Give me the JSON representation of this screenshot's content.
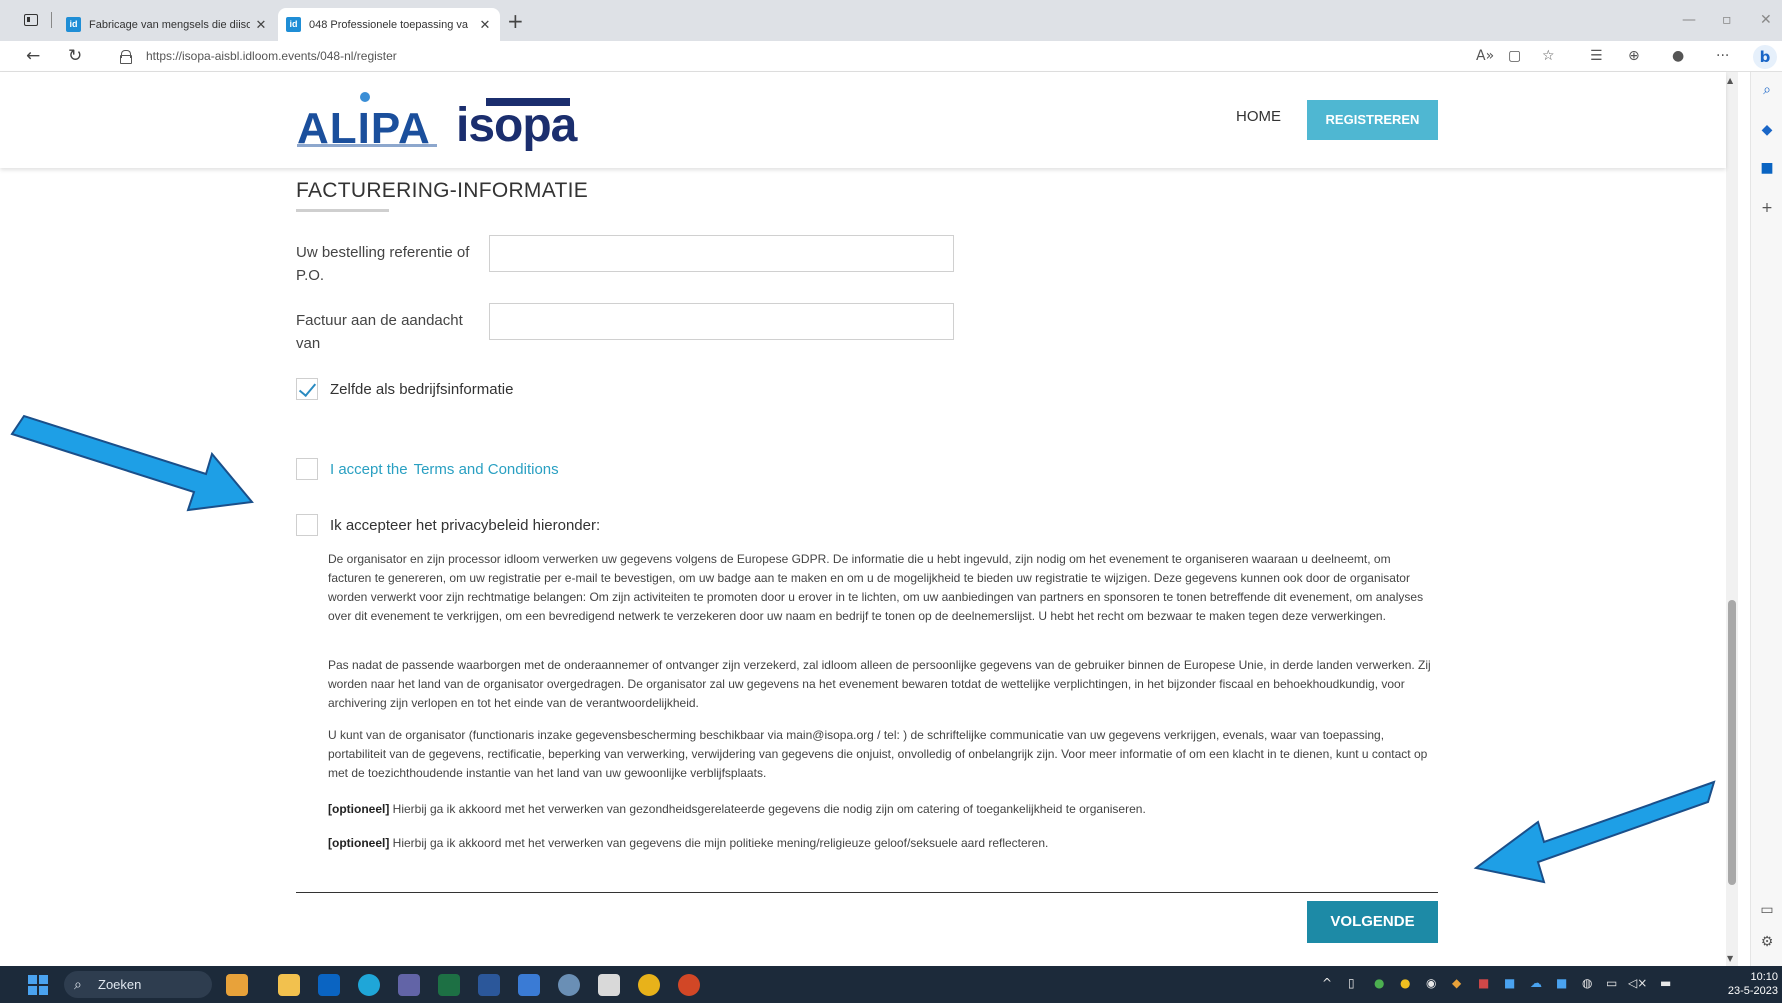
{
  "browser": {
    "tabs": [
      {
        "title": "Fabricage van mengsels die diiso",
        "favicon": "id"
      },
      {
        "title": "048 Professionele toepassing va",
        "favicon": "id"
      }
    ],
    "url": "https://isopa-aisbl.idloom.events/048-nl/register"
  },
  "header": {
    "logo_alipa": "ALIPA",
    "logo_isopa": "isopa",
    "nav_home": "HOME",
    "nav_register": "REGISTREREN"
  },
  "form": {
    "section_title": "FACTURERING-INFORMATIE",
    "order_ref_label": "Uw bestelling referentie of P.O.",
    "order_ref_value": "",
    "attention_label": "Factuur aan de aandacht van",
    "attention_value": "",
    "same_as_company_label": "Zelfde als bedrijfsinformatie",
    "same_as_company_checked": true,
    "terms_prefix": "I accept the",
    "terms_link": "Terms and Conditions",
    "terms_checked": false,
    "privacy_label": "Ik accepteer het privacybeleid hieronder:",
    "privacy_checked": false,
    "privacy_p1": "De organisator en zijn processor idloom verwerken uw gegevens volgens de Europese GDPR. De informatie die u hebt ingevuld, zijn nodig om het evenement te organiseren waaraan u deelneemt, om facturen te genereren, om uw registratie per e-mail te bevestigen, om uw badge aan te maken en om u de mogelijkheid te bieden uw registratie te wijzigen. Deze gegevens kunnen ook door de organisator worden verwerkt voor zijn rechtmatige belangen: Om zijn activiteiten te promoten door u erover in te lichten, om uw aanbiedingen van partners en sponsoren te tonen betreffende dit evenement, om analyses over dit evenement te verkrijgen, om een bevredigend netwerk te verzekeren door uw naam en bedrijf te tonen op de deelnemerslijst. U hebt het recht om bezwaar te maken tegen deze verwerkingen.",
    "privacy_p2": "Pas nadat de passende waarborgen met de onderaannemer of ontvanger zijn verzekerd, zal idloom alleen de persoonlijke gegevens van de gebruiker binnen de Europese Unie, in derde landen verwerken. Zij worden naar het land van de organisator overgedragen. De organisator zal uw gegevens na het evenement bewaren totdat de wettelijke verplichtingen, in het bijzonder fiscaal en behoekhoudkundig, voor archivering zijn verlopen en tot het einde van de verantwoordelijkheid.",
    "privacy_p3": "U kunt van de organisator (functionaris inzake gegevensbescherming beschikbaar via main@isopa.org / tel: ) de schriftelijke communicatie van uw gegevens verkrijgen, evenals, waar van toepassing, portabiliteit van de gegevens, rectificatie, beperking van verwerking, verwijdering van gegevens die onjuist, onvolledig of onbelangrijk zijn. Voor meer informatie of om een klacht in te dienen, kunt u contact op met de toezichthoudende instantie van het land van uw gewoonlijke verblijfsplaats.",
    "optional_tag": "[optioneel]",
    "optional_1": " Hierbij ga ik akkoord met het verwerken van gezondheidsgerelateerde gegevens die nodig zijn om catering of toegankelijkheid te organiseren.",
    "optional_2": " Hierbij ga ik akkoord met het verwerken van gegevens die mijn politieke mening/religieuze geloof/seksuele aard reflecteren.",
    "next_button": "VOLGENDE"
  },
  "taskbar": {
    "search_placeholder": "Zoeken",
    "time": "10:10",
    "date": "23-5-2023"
  },
  "colors": {
    "accent": "#4fb7d2",
    "next_button": "#1d8aa6",
    "link": "#2aa0c2",
    "arrow": "#1e9fe6"
  }
}
